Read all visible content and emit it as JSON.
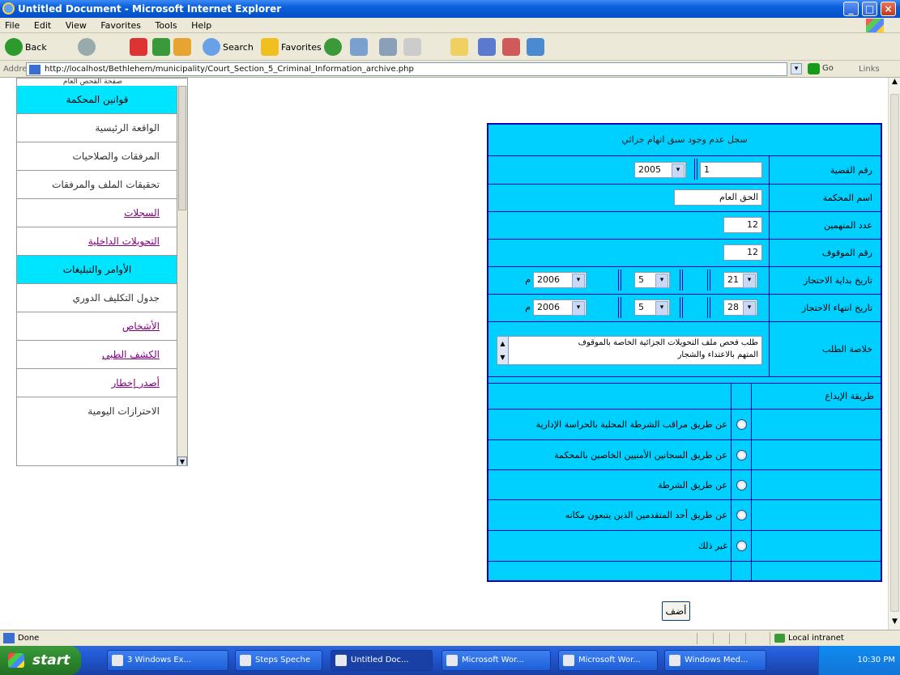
{
  "window": {
    "title": "Untitled Document - Microsoft Internet Explorer"
  },
  "menu": [
    "File",
    "Edit",
    "View",
    "Favorites",
    "Tools",
    "Help"
  ],
  "toolbar": {
    "back": "Back",
    "search": "Search",
    "favorites": "Favorites"
  },
  "address": {
    "label": "Address",
    "url": "http://localhost/Bethlehem/municipality/Court_Section_5_Criminal_Information_archive.php",
    "go": "Go",
    "links": "Links"
  },
  "sidebar": {
    "top_clip": "صفحة الفحص العام",
    "items": [
      {
        "label": "قوانين المحكمة",
        "highlight": true
      },
      {
        "label": "الواقعة الرئيسية",
        "link": false
      },
      {
        "label": "المرفقات والصلاحيات",
        "link": false
      },
      {
        "label": "تحقيقات الملف والمرفقات",
        "link": false
      },
      {
        "label": "السجلات",
        "link": true
      },
      {
        "label": "التحويلات الداخلية",
        "link": true
      },
      {
        "label": "الأوامر والتبليغات",
        "highlight": true
      },
      {
        "label": "جدول التكليف الدوري",
        "link": false
      },
      {
        "label": "الأشخاص",
        "link": true
      },
      {
        "label": "الكشف الطبي",
        "link": true
      },
      {
        "label": "أصدر إخطار",
        "link": true
      },
      {
        "label": "الاحترازات اليومية",
        "link": false
      }
    ]
  },
  "form": {
    "header": "سجل عدم وجود سبق اتهام جزائي",
    "fields": {
      "case_no": {
        "label": "رقم القضية",
        "number": "1",
        "year": "2005"
      },
      "court": {
        "label": "اسم المحكمة",
        "value": "الحق العام"
      },
      "defendants": {
        "label": "عدد المتهمين",
        "value": "12"
      },
      "suspects": {
        "label": "رقم الموقوف",
        "value": "12"
      },
      "start_date": {
        "label": "تاريخ بداية الاحتجاز",
        "day": "21",
        "month": "5",
        "year": "2006",
        "unit": "م"
      },
      "end_date": {
        "label": "تاريخ انتهاء الاحتجاز",
        "day": "28",
        "month": "5",
        "year": "2006",
        "unit": "م"
      },
      "summary": {
        "label": "خلاصة الطلب",
        "line1": "طلب فحص ملف التحويلات الجزائية الخاصة بالموقوف",
        "line2": "المتهم بالاعتداء والشجار"
      }
    },
    "submission": {
      "label": "طريقة الإيداع",
      "options": [
        "عن طريق مراقب الشرطة المحلية بالحراسة الإدارية",
        "عن طريق السجانين الأمنيين الخاصين بالمحكمة",
        "عن طريق الشرطة",
        "عن طريق أحد المتقدمين الذين يتبعون مكانه",
        "غير ذلك"
      ]
    },
    "submit": "أضف"
  },
  "status": {
    "text": "Done",
    "zone": "Local intranet"
  },
  "taskbar": {
    "start": "start",
    "tasks": [
      "3 Windows Ex...",
      "Steps Speche",
      "Untitled Doc...",
      "Microsoft Wor...",
      "Microsoft Wor...",
      "Windows Med..."
    ],
    "clock": "10:30 PM"
  }
}
